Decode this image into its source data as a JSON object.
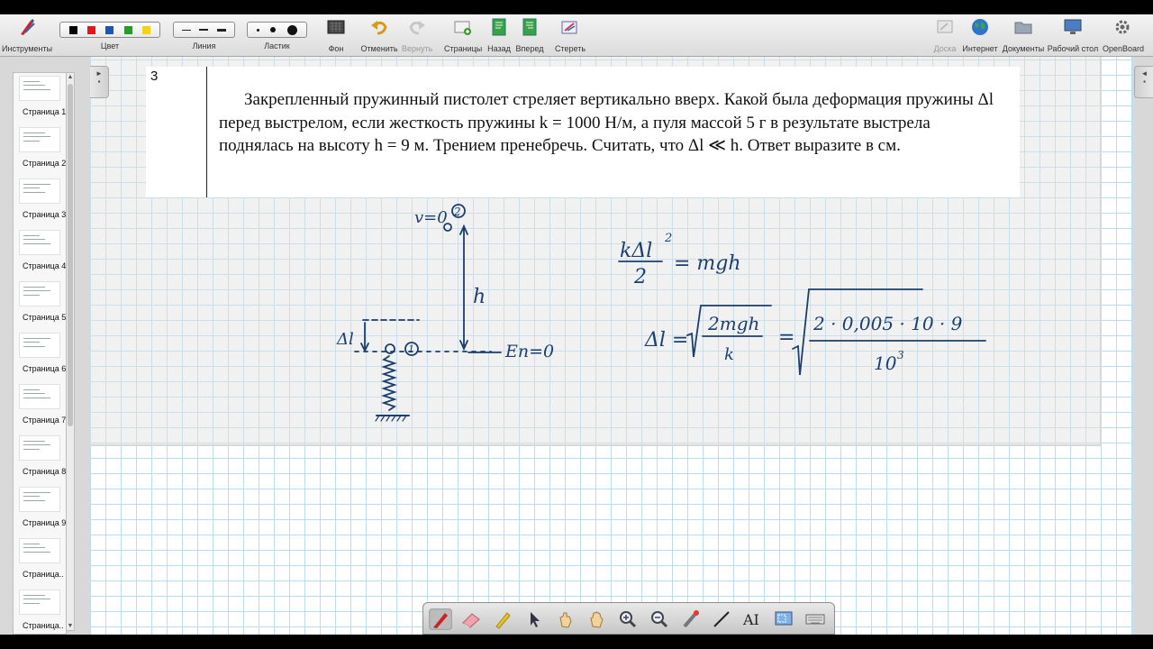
{
  "toolbar": {
    "tools_label": "Инструменты",
    "color_label": "Цвет",
    "line_label": "Линия",
    "eraser_label": "Ластик",
    "background_label": "Фон",
    "undo_label": "Отменить",
    "redo_label": "Вернуть",
    "pages_label": "Страницы",
    "back_label": "Назад",
    "forward_label": "Вперед",
    "erase_label": "Стереть",
    "board_label": "Доска",
    "internet_label": "Интернет",
    "documents_label": "Документы",
    "desktop_label": "Рабочий стол",
    "openboard_label": "OpenBoard",
    "colors": [
      "#000000",
      "#e8141b",
      "#1a56b8",
      "#2a9a2a",
      "#f2d21a"
    ]
  },
  "problem": {
    "number": "3",
    "text": "Закрепленный пружинный пистолет стреляет вертикально вверх. Какой была деформация пружины Δl перед выстрелом, если жесткость пружины  k = 1000 Н/м,  а пуля массой 5 г в результате выстрела поднялась на высоту  h = 9 м. Трением пренебречь. Считать, что  Δl ≪ h. Ответ выразите в см."
  },
  "handwriting": {
    "v0": "v=0",
    "point2": "2",
    "point1": "1",
    "h": "h",
    "dl": "Δl",
    "ep0": "Eп=0",
    "eq1_num": "kΔl",
    "eq1_exp": "2",
    "eq1_den": "2",
    "eq1_rhs": "= mgh",
    "eq2_lhs": "Δl =",
    "eq2_num": "2mgh",
    "eq2_den": "k",
    "eq2_eq": "=",
    "eq2_num2": "2 · 0,005 · 10 · 9",
    "eq2_den2": "10",
    "eq2_exp2": "3"
  },
  "pages": [
    {
      "label": "Страница 1"
    },
    {
      "label": "Страница 2"
    },
    {
      "label": "Страница 3"
    },
    {
      "label": "Страница 4"
    },
    {
      "label": "Страница 5"
    },
    {
      "label": "Страница 6"
    },
    {
      "label": "Страница 7"
    },
    {
      "label": "Страница 8"
    },
    {
      "label": "Страница 9"
    },
    {
      "label": "Страница.."
    },
    {
      "label": "Страница.."
    }
  ],
  "ink_color": "#1b3f6e"
}
